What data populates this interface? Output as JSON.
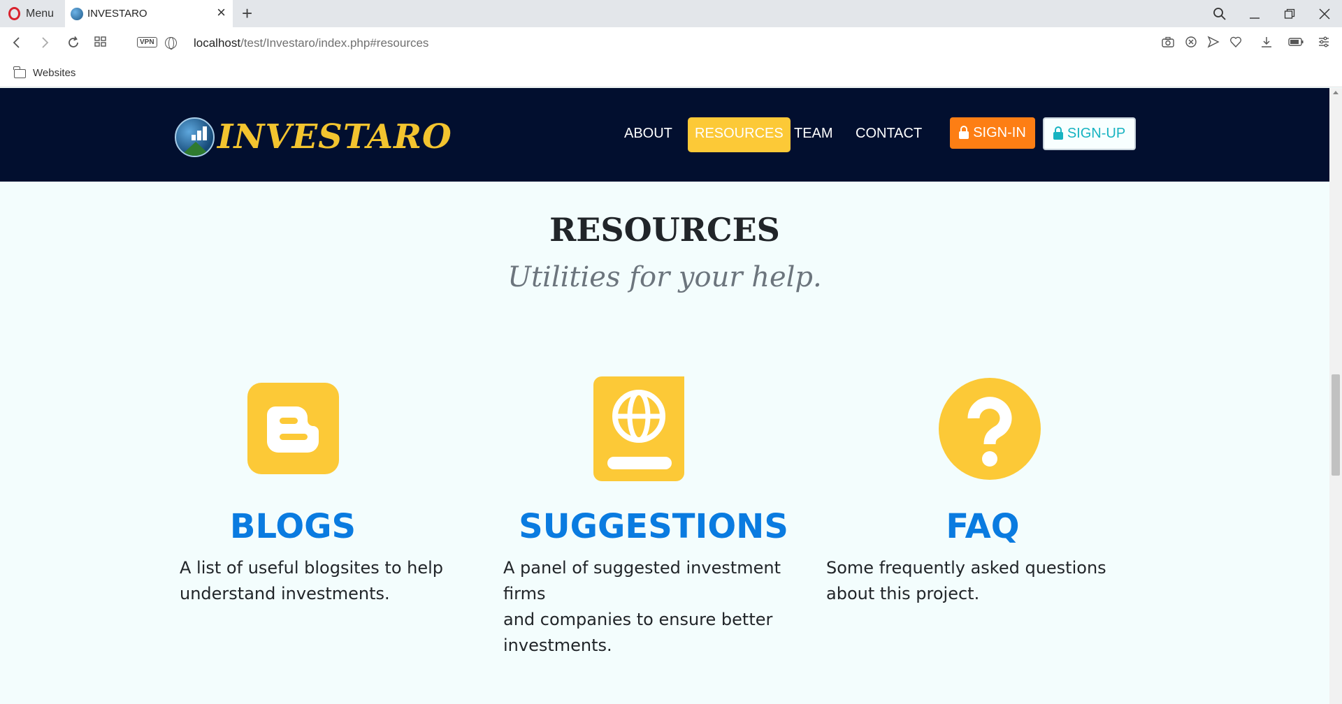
{
  "browser": {
    "menu_label": "Menu",
    "tab_title": "INVESTARO",
    "url_host": "localhost",
    "url_path": "/test/Investaro/index.php#resources",
    "vpn_label": "VPN",
    "bookmark_folder": "Websites"
  },
  "site": {
    "logo_text": "INVESTARO",
    "nav": [
      {
        "label": "ABOUT"
      },
      {
        "label": "RESOURCES"
      },
      {
        "label": "TEAM"
      },
      {
        "label": "CONTACT"
      }
    ],
    "signin_label": "SIGN-IN",
    "signup_label": "SIGN-UP",
    "accent_color": "#fcc937",
    "nav_bg_color": "#020f2f"
  },
  "section": {
    "title": "RESOURCES",
    "subtitle": "Utilities for your help.",
    "items": [
      {
        "icon": "blogger-icon",
        "title": "BLOGS",
        "desc_lines": [
          "A list of useful blogsites to help",
          "understand investments."
        ]
      },
      {
        "icon": "globe-book-icon",
        "title": "SUGGESTIONS",
        "desc_lines": [
          "A panel of suggested investment firms",
          "and companies to ensure better",
          "investments."
        ]
      },
      {
        "icon": "question-circle-icon",
        "title": "FAQ",
        "desc_lines": [
          "Some frequently asked questions",
          "about this project."
        ]
      }
    ]
  }
}
